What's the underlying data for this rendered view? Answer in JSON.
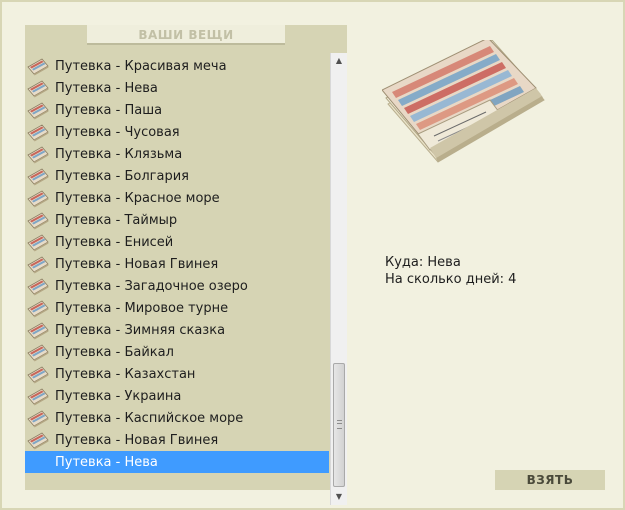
{
  "inventory": {
    "header": "ВАШИ ВЕЩИ",
    "items": [
      {
        "label": "Путевка - Красивая меча",
        "icon": "ticket-icon"
      },
      {
        "label": "Путевка - Нева",
        "icon": "ticket-icon"
      },
      {
        "label": "Путевка - Паша",
        "icon": "ticket-icon"
      },
      {
        "label": "Путевка - Чусовая",
        "icon": "ticket-icon"
      },
      {
        "label": "Путевка - Клязьма",
        "icon": "ticket-icon"
      },
      {
        "label": "Путевка - Болгария",
        "icon": "ticket-icon"
      },
      {
        "label": "Путевка - Красное море",
        "icon": "ticket-icon"
      },
      {
        "label": "Путевка - Таймыр",
        "icon": "ticket-icon"
      },
      {
        "label": "Путевка - Енисей",
        "icon": "ticket-icon"
      },
      {
        "label": "Путевка - Новая Гвинея",
        "icon": "ticket-icon"
      },
      {
        "label": "Путевка - Загадочное озеро",
        "icon": "ticket-icon"
      },
      {
        "label": "Путевка - Мировое турне",
        "icon": "ticket-icon"
      },
      {
        "label": "Путевка - Зимняя сказка",
        "icon": "ticket-icon"
      },
      {
        "label": "Путевка - Байкал",
        "icon": "ticket-icon"
      },
      {
        "label": "Путевка - Казахстан",
        "icon": "ticket-icon"
      },
      {
        "label": "Путевка - Украина",
        "icon": "ticket-icon"
      },
      {
        "label": "Путевка - Каспийское море",
        "icon": "ticket-icon"
      },
      {
        "label": "Путевка - Новая Гвинея",
        "icon": "ticket-icon"
      },
      {
        "label": "Путевка - Нева",
        "icon": "",
        "selected": true
      }
    ],
    "selected_index": 18,
    "scroll_position": 0.95,
    "scroll_up_icon": "scroll-up-arrow-icon",
    "scroll_down_icon": "scroll-down-arrow-icon"
  },
  "preview": {
    "image_icon": "ticket-bundle-image",
    "destination_label": "Куда: Нева",
    "days_label": "На сколько дней: 4"
  },
  "actions": {
    "take_label": "ВЗЯТЬ"
  },
  "colors": {
    "page_background": "#f2f1e0",
    "panel_background": "#d6d4b4",
    "selection": "#3f9bff",
    "button_background": "#d6d4b4"
  }
}
